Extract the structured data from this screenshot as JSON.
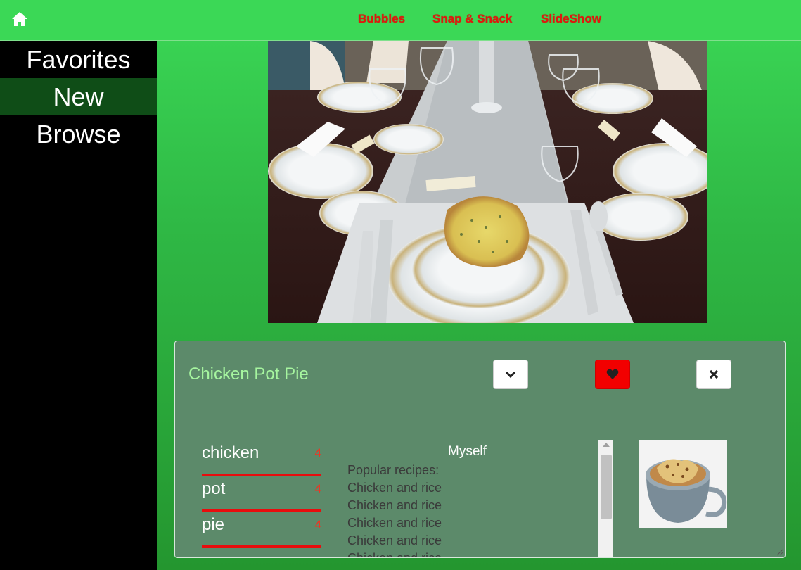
{
  "nav": {
    "home_icon": "home-icon",
    "links": [
      "Bubbles",
      "Snap & Snack",
      "SlideShow"
    ],
    "link_color": "#e0190e"
  },
  "sidebar": {
    "items": [
      {
        "label": "Favorites",
        "active": false
      },
      {
        "label": "New",
        "active": true
      },
      {
        "label": "Browse",
        "active": false
      }
    ]
  },
  "hero": {
    "icon": "dinner-table-photo"
  },
  "card": {
    "title": "Chicken Pot Pie",
    "buttons": {
      "expand_icon": "chevron-down-icon",
      "favorite_icon": "heart-icon",
      "close_icon": "close-icon"
    },
    "ingredients": [
      {
        "name": "chicken",
        "count": "4"
      },
      {
        "name": "pot",
        "count": "4"
      },
      {
        "name": "pie",
        "count": "4"
      }
    ],
    "author": "Myself",
    "recipes_heading": "Popular recipes:",
    "recipes": [
      "Chicken and rice",
      "Chicken and rice",
      "Chicken and rice",
      "Chicken and rice",
      "Chicken and rice"
    ],
    "thumbnail_icon": "onion-soup-photo"
  },
  "colors": {
    "accent_green": "#3bd856",
    "title_green": "#a6f59f",
    "favorite_red": "#f20000",
    "underline_red": "#e80d0d"
  }
}
